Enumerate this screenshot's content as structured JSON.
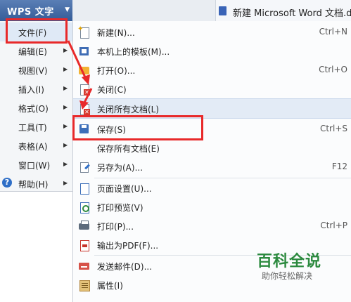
{
  "titlebar": {
    "app_menu": "WPS 文字",
    "document_tab": "新建 Microsoft Word 文档.do"
  },
  "left_menu": {
    "items": [
      {
        "label": "文件(F)",
        "has_submenu": false,
        "active": true
      },
      {
        "label": "编辑(E)",
        "has_submenu": true
      },
      {
        "label": "视图(V)",
        "has_submenu": true
      },
      {
        "label": "插入(I)",
        "has_submenu": true
      },
      {
        "label": "格式(O)",
        "has_submenu": true
      },
      {
        "label": "工具(T)",
        "has_submenu": true
      },
      {
        "label": "表格(A)",
        "has_submenu": true
      },
      {
        "label": "窗口(W)",
        "has_submenu": true
      },
      {
        "label": "帮助(H)",
        "has_submenu": true,
        "icon": "help-icon"
      }
    ]
  },
  "file_menu": {
    "items": [
      {
        "label": "新建(N)...",
        "shortcut": "Ctrl+N",
        "icon": "new-document-icon"
      },
      {
        "label": "本机上的模板(M)...",
        "shortcut": "",
        "icon": "template-icon"
      },
      {
        "label": "打开(O)...",
        "shortcut": "Ctrl+O",
        "icon": "open-folder-icon"
      },
      {
        "label": "关闭(C)",
        "shortcut": "",
        "icon": "close-document-icon"
      },
      {
        "label": "关闭所有文档(L)",
        "shortcut": "",
        "icon": "close-all-icon",
        "highlighted": true
      },
      {
        "label": "保存(S)",
        "shortcut": "Ctrl+S",
        "icon": "save-icon"
      },
      {
        "label": "保存所有文档(E)",
        "shortcut": "",
        "icon": ""
      },
      {
        "label": "另存为(A)...",
        "shortcut": "F12",
        "icon": "save-as-icon"
      },
      {
        "label": "页面设置(U)...",
        "shortcut": "",
        "icon": "page-setup-icon"
      },
      {
        "label": "打印预览(V)",
        "shortcut": "",
        "icon": "print-preview-icon"
      },
      {
        "label": "打印(P)...",
        "shortcut": "Ctrl+P",
        "icon": "printer-icon"
      },
      {
        "label": "输出为PDF(F)...",
        "shortcut": "",
        "icon": "pdf-icon"
      },
      {
        "label": "发送邮件(D)...",
        "shortcut": "",
        "icon": "mail-icon"
      },
      {
        "label": "属性(I)",
        "shortcut": "",
        "icon": "properties-icon"
      }
    ]
  },
  "watermark": {
    "title": "百科全说",
    "subtitle": "助你轻松解决"
  },
  "colors": {
    "annotation": "#e8292a",
    "highlight": "#e3ebf6",
    "brand_green": "#2c8a3f"
  }
}
